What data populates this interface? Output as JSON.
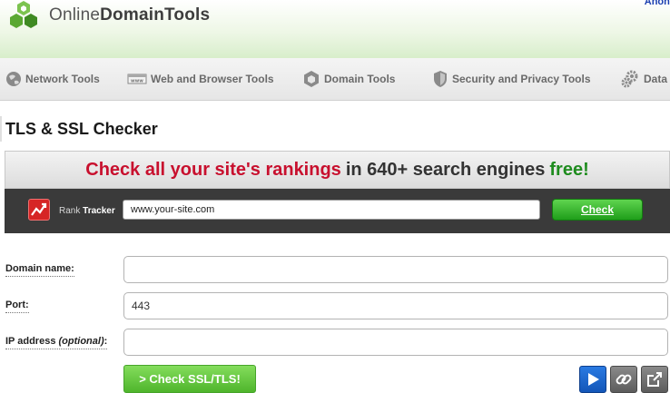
{
  "header": {
    "logo_light": "Online",
    "logo_bold": "DomainTools",
    "user_link": "Anony"
  },
  "nav": {
    "items": [
      {
        "label": "Network Tools",
        "icon": "globe-icon"
      },
      {
        "label": "Web and Browser Tools",
        "icon": "browser-window-icon"
      },
      {
        "label": "Domain Tools",
        "icon": "hexagon-icon"
      },
      {
        "label": "Security and Privacy Tools",
        "icon": "shield-icon"
      },
      {
        "label": "Data a",
        "icon": "gears-icon"
      }
    ]
  },
  "page": {
    "title": "TLS & SSL Checker"
  },
  "ad": {
    "headline_red": "Check all your site's rankings",
    "headline_dark": "in 640+ search engines",
    "headline_green": "free!",
    "tracker_label_light": "Rank",
    "tracker_label_bold": "Tracker",
    "url_value": "www.your-site.com",
    "check_label": "Check",
    "colors": {
      "red": "#c8102e",
      "green": "#1f8c1f",
      "bar": "#3a3a3a"
    }
  },
  "form": {
    "domain_label": "Domain name:",
    "domain_value": "",
    "port_label": "Port:",
    "port_value": "443",
    "ip_label_prefix": "IP address",
    "ip_label_optional": "(optional)",
    "ip_label_suffix": ":",
    "ip_value": "",
    "submit_label": "> Check SSL/TLS!"
  },
  "tools": {
    "icons": [
      "play-icon",
      "link-icon",
      "external-link-icon"
    ]
  }
}
